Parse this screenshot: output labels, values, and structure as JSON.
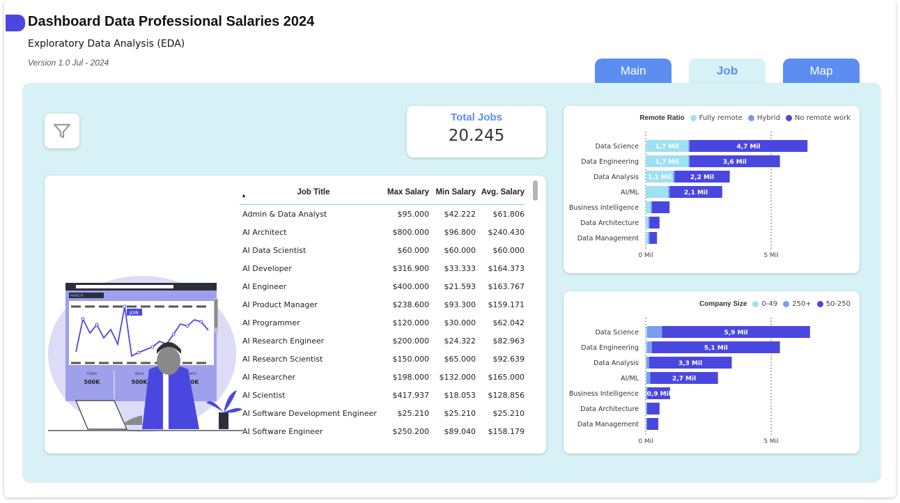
{
  "header": {
    "title": "Dashboard Data Professional Salaries 2024",
    "subtitle": "Exploratory Data Analysis (EDA)",
    "version": "Version 1.0 Jul - 2024"
  },
  "tabs": [
    {
      "label": "Main",
      "active": false
    },
    {
      "label": "Job",
      "active": true
    },
    {
      "label": "Map",
      "active": false
    }
  ],
  "kpi": {
    "label": "Total Jobs",
    "value": "20.245"
  },
  "table": {
    "sort_indicator": "▲",
    "headers": [
      "Job Title",
      "Max Salary",
      "Min Salary",
      "Avg. Salary"
    ],
    "rows": [
      [
        "Admin & Data Analyst",
        "$95.000",
        "$42.222",
        "$61.806"
      ],
      [
        "AI Architect",
        "$800.000",
        "$96.800",
        "$240.430"
      ],
      [
        "AI Data Scientist",
        "$60.000",
        "$60.000",
        "$60.000"
      ],
      [
        "AI Developer",
        "$316.900",
        "$33.333",
        "$164.373"
      ],
      [
        "AI Engineer",
        "$400.000",
        "$21.593",
        "$163.767"
      ],
      [
        "AI Product Manager",
        "$238.600",
        "$93.300",
        "$159.171"
      ],
      [
        "AI Programmer",
        "$120.000",
        "$30.000",
        "$62.042"
      ],
      [
        "AI Research Engineer",
        "$200.000",
        "$24.322",
        "$82.963"
      ],
      [
        "AI Research Scientist",
        "$150.000",
        "$65.000",
        "$92.639"
      ],
      [
        "AI Researcher",
        "$198.000",
        "$132.000",
        "$165.000"
      ],
      [
        "AI Scientist",
        "$417.937",
        "$18.053",
        "$128.856"
      ],
      [
        "AI Software Development Engineer",
        "$25.210",
        "$25.210",
        "$25.210"
      ],
      [
        "AI Software Engineer",
        "$250.200",
        "$89.040",
        "$158.179"
      ]
    ]
  },
  "illustration": {
    "screen_tag": "MARCH",
    "point_tag": "JOIN",
    "stats": [
      {
        "label": "TODAY",
        "value": "500K"
      },
      {
        "label": "WEEK",
        "value": "500K"
      },
      {
        "label": "MONTH",
        "value": "500K"
      }
    ]
  },
  "colors": {
    "accent": "#4a47e0",
    "tab": "#5b8ef0",
    "panel": "#d7f1f6",
    "series_light": "#9ee1f0",
    "series_mid": "#7a9df0",
    "series_dark": "#4a47e0"
  },
  "icons": {
    "filter": "filter-icon"
  },
  "chart_data": [
    {
      "type": "bar",
      "orientation": "horizontal",
      "stacked": true,
      "legend_title": "Remote Ratio",
      "legend_position": "top-right",
      "categories": [
        "Data Science",
        "Data Engineering",
        "Data Analysis",
        "AI/ML",
        "Business Intelligence",
        "Data Architecture",
        "Data Management"
      ],
      "series": [
        {
          "name": "Fully remote",
          "color": "#9ee1f0",
          "values": [
            1.7,
            1.7,
            1.1,
            0.9,
            0.2,
            0.1,
            0.1
          ],
          "labels": [
            "1,7 Mil",
            "1,7 Mil",
            "1,1 Mil",
            "",
            "",
            "",
            ""
          ]
        },
        {
          "name": "Hybrid",
          "color": "#7a9df0",
          "values": [
            0.05,
            0.05,
            0.05,
            0.05,
            0.05,
            0.05,
            0.05
          ],
          "labels": [
            "",
            "",
            "",
            "",
            "",
            "",
            ""
          ]
        },
        {
          "name": "No remote work",
          "color": "#4a47e0",
          "values": [
            4.7,
            3.6,
            2.2,
            2.1,
            0.7,
            0.4,
            0.3
          ],
          "labels": [
            "4,7 Mil",
            "3,6 Mil",
            "2,2 Mil",
            "2,1 Mil",
            "",
            "",
            ""
          ]
        }
      ],
      "xticks": [
        "0 Mil",
        "5 Mil"
      ],
      "xlim": [
        0,
        6.5
      ]
    },
    {
      "type": "bar",
      "orientation": "horizontal",
      "stacked": true,
      "legend_title": "Company Size",
      "legend_position": "top-right",
      "categories": [
        "Data Science",
        "Data Engineering",
        "Data Analysis",
        "AI/ML",
        "Business Intelligence",
        "Data Architecture",
        "Data Management"
      ],
      "series": [
        {
          "name": "0-49",
          "color": "#9ee1f0",
          "values": [
            0.05,
            0.05,
            0.03,
            0.03,
            0.02,
            0.02,
            0.02
          ],
          "labels": [
            "",
            "",
            "",
            "",
            "",
            "",
            ""
          ]
        },
        {
          "name": "250+",
          "color": "#7a9df0",
          "values": [
            0.6,
            0.2,
            0.1,
            0.15,
            0.05,
            0.03,
            0.03
          ],
          "labels": [
            "",
            "",
            "",
            "",
            "",
            "",
            ""
          ]
        },
        {
          "name": "50-250",
          "color": "#4a47e0",
          "values": [
            5.9,
            5.1,
            3.3,
            2.7,
            0.9,
            0.5,
            0.45
          ],
          "labels": [
            "5,9 Mil",
            "5,1 Mil",
            "3,3 Mil",
            "2,7 Mil",
            "0,9 Mil",
            "",
            ""
          ]
        }
      ],
      "xticks": [
        "0 Mil",
        "5 Mil"
      ],
      "xlim": [
        0,
        6.5
      ]
    }
  ]
}
